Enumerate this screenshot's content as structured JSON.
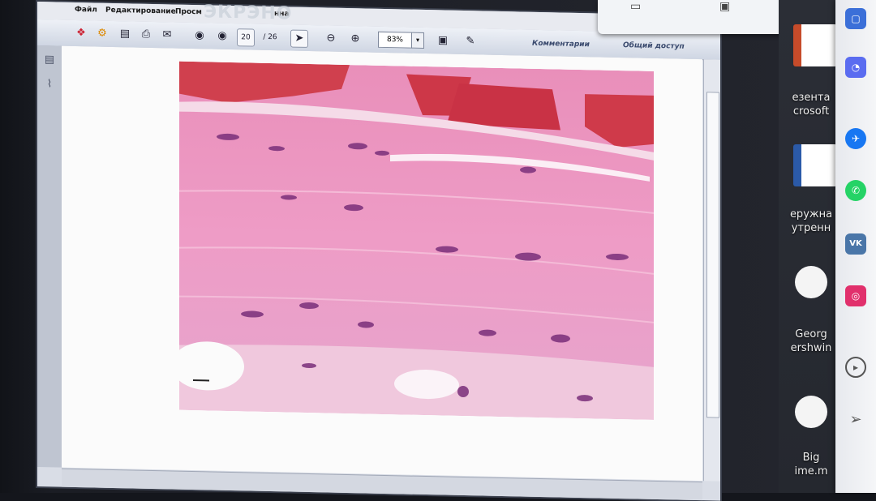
{
  "menu": {
    "file": "Файл",
    "edit": "Редактирование",
    "view": "Просм",
    "window": "нна",
    "watermark": "ЭКРЭНО"
  },
  "toolbar": {
    "page_current": "20",
    "page_total": "/ 26",
    "zoom": "83%",
    "comments": "Комментарии",
    "share": "Общий доступ"
  },
  "desktop": {
    "items": [
      {
        "label": "езента\ncrosoft",
        "icon": "powerpoint-file-icon"
      },
      {
        "label": "еружна\nутренн",
        "icon": "word-file-icon"
      },
      {
        "label": "Georg\nershwin",
        "icon": "audio-file-icon"
      },
      {
        "label": "Big\nime.m",
        "icon": "audio-file-icon"
      }
    ]
  },
  "tray": {
    "apps": [
      "facebook-messenger-icon",
      "whatsapp-icon",
      "vk-icon",
      "instagram-icon",
      "play-icon",
      "send-icon"
    ],
    "vk_text": "VK"
  },
  "colors": {
    "tissue_pink": "#e8a0c8",
    "muscle_red": "#c83a4c",
    "nucleus_purple": "#7a2f7a"
  }
}
